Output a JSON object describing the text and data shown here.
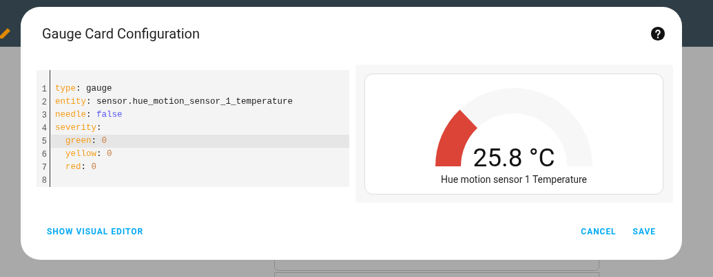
{
  "dialog": {
    "title": "Gauge Card Configuration",
    "editor": {
      "lines": [
        {
          "number": "1",
          "active": false,
          "indented": false,
          "tokens": [
            {
              "kind": "key",
              "text": "type"
            },
            {
              "kind": "punct",
              "text": ": "
            },
            {
              "kind": "plain",
              "text": "gauge"
            }
          ]
        },
        {
          "number": "2",
          "active": false,
          "indented": false,
          "tokens": [
            {
              "kind": "key",
              "text": "entity"
            },
            {
              "kind": "punct",
              "text": ": "
            },
            {
              "kind": "plain",
              "text": "sensor.hue_motion_sensor_1_temperature"
            }
          ]
        },
        {
          "number": "3",
          "active": false,
          "indented": false,
          "tokens": [
            {
              "kind": "key",
              "text": "needle"
            },
            {
              "kind": "punct",
              "text": ": "
            },
            {
              "kind": "bool",
              "text": "false"
            }
          ]
        },
        {
          "number": "4",
          "active": false,
          "indented": false,
          "tokens": [
            {
              "kind": "key",
              "text": "severity"
            },
            {
              "kind": "punct",
              "text": ":"
            }
          ]
        },
        {
          "number": "5",
          "active": true,
          "indented": true,
          "tokens": [
            {
              "kind": "key",
              "text": "green"
            },
            {
              "kind": "punct",
              "text": ": "
            },
            {
              "kind": "number",
              "text": "0"
            }
          ]
        },
        {
          "number": "6",
          "active": false,
          "indented": true,
          "tokens": [
            {
              "kind": "key",
              "text": "yellow"
            },
            {
              "kind": "punct",
              "text": ": "
            },
            {
              "kind": "number",
              "text": "0"
            }
          ]
        },
        {
          "number": "7",
          "active": false,
          "indented": true,
          "tokens": [
            {
              "kind": "key",
              "text": "red"
            },
            {
              "kind": "punct",
              "text": ": "
            },
            {
              "kind": "number",
              "text": "0"
            }
          ]
        },
        {
          "number": "8",
          "active": false
        }
      ]
    },
    "preview": {
      "gauge": {
        "value": "25.8 °C",
        "name": "Hue motion sensor 1 Temperature"
      }
    },
    "footer": {
      "left_buttons": [
        "SHOW VISUAL EDITOR"
      ],
      "right_buttons": [
        "CANCEL",
        "SAVE"
      ]
    }
  }
}
